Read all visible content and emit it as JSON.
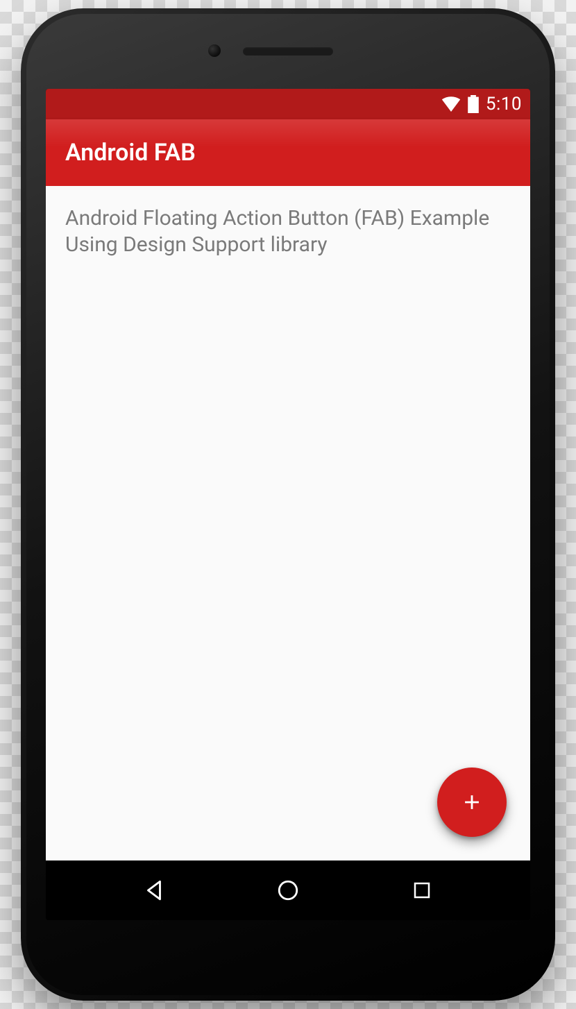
{
  "status_bar": {
    "time": "5:10"
  },
  "toolbar": {
    "title": "Android FAB"
  },
  "content": {
    "body_text": "Android Floating Action Button (FAB) Example Using Design Support library"
  },
  "colors": {
    "primary": "#d11e1e",
    "primary_dark": "#b11a1a",
    "fab": "#d11e1e",
    "content_bg": "#fafafa",
    "body_text": "#7a7a7a"
  }
}
